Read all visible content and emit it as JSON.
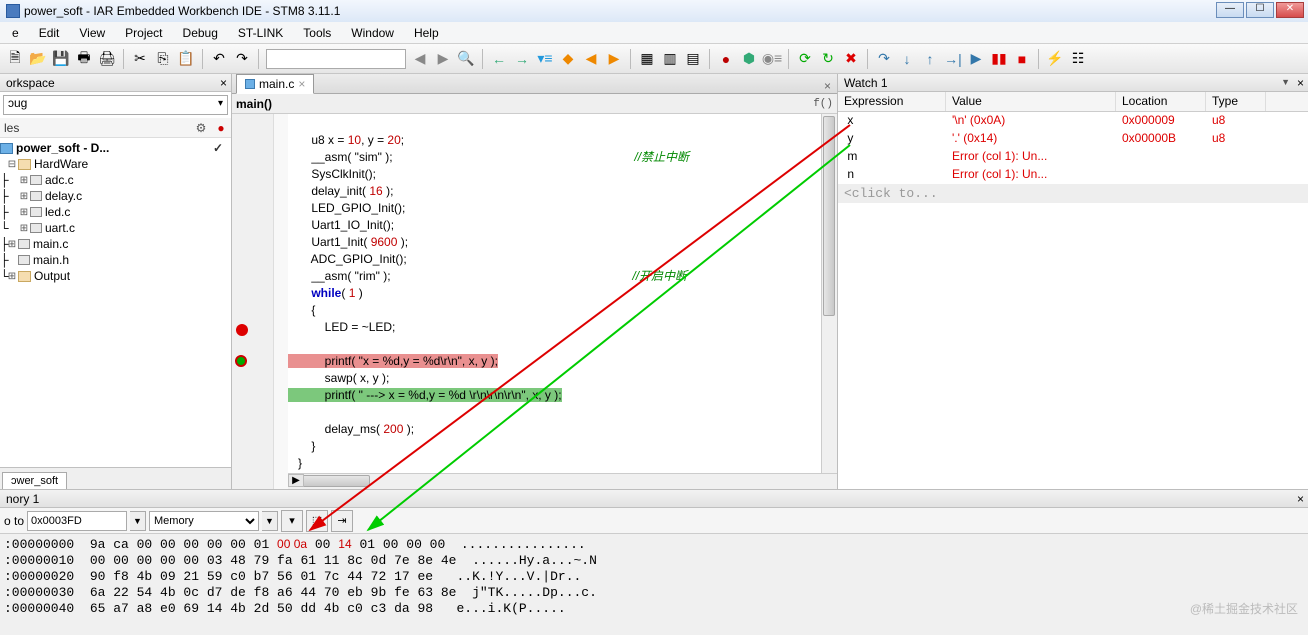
{
  "title": "power_soft - IAR Embedded Workbench IDE - STM8 3.11.1",
  "menu": [
    "e",
    "Edit",
    "View",
    "Project",
    "Debug",
    "ST-LINK",
    "Tools",
    "Window",
    "Help"
  ],
  "workspace": {
    "header": "orkspace",
    "dropdown": "ɔug",
    "files_label": "les",
    "project": "power_soft - D...",
    "hardware": "HardWare",
    "files": [
      "adc.c",
      "delay.c",
      "led.c",
      "uart.c"
    ],
    "main_c": "main.c",
    "main_h": "main.h",
    "output": "Output",
    "tab": "ɔwer_soft"
  },
  "editor": {
    "tab": "main.c",
    "func": "main()",
    "fo": "f()",
    "lines": {
      "l0": "       u8 x = ",
      "l0n1": "10",
      "l0m": ", y = ",
      "l0n2": "20",
      "l0e": ";",
      "l1": "       __asm( \"sim\" );",
      "l1c": "//禁止中断",
      "l2": "       SysClkInit();",
      "l3": "       delay_init( ",
      "l3n": "16",
      "l3e": " );",
      "l4": "       LED_GPIO_Init();",
      "l5": "       Uart1_IO_Init();",
      "l6": "       Uart1_Init( ",
      "l6n": "9600",
      "l6e": " );",
      "l7": "       ADC_GPIO_Init();",
      "l8": "       __asm( \"rim\" );",
      "l8c": "//开启中断",
      "l9a": "       ",
      "l9k": "while",
      "l9b": "( ",
      "l9n": "1",
      "l9e": " )",
      "l10": "       {",
      "l11": "           LED = ~LED;",
      "l12": "",
      "l13a": "           printf( \"x = %d,y = %d\\r\\n\", x, y );",
      "l14": "           sawp( x, y );",
      "l15a": "           printf( \" ---> x = %d,y = %d \\r\\n\\r\\n\\r\\n\", x, y );",
      "l16": "",
      "l17": "           delay_ms( ",
      "l17n": "200",
      "l17e": " );",
      "l18": "       }",
      "l19": "   }"
    }
  },
  "watch": {
    "header": "Watch 1",
    "th_expr": "Expression",
    "th_val": "Value",
    "th_loc": "Location",
    "th_type": "Type",
    "rows": [
      {
        "expr": "x",
        "val": "'\\n' (0x0A)",
        "loc": "0x000009",
        "type": "u8",
        "red": true
      },
      {
        "expr": "y",
        "val": "'.' (0x14)",
        "loc": "0x00000B",
        "type": "u8",
        "red": true
      },
      {
        "expr": "m",
        "val": "Error (col 1): Un...",
        "loc": "",
        "type": "",
        "red": true
      },
      {
        "expr": "n",
        "val": "Error (col 1): Un...",
        "loc": "",
        "type": "",
        "red": true
      }
    ],
    "click_add": "<click to..."
  },
  "memory": {
    "header": "nory 1",
    "goto_label": "o to",
    "goto_addr": "0x0003FD",
    "region": "Memory",
    "lines": [
      {
        "addr": ":00000000",
        "hex": "9a ca 00 00 00 00 00 01 ",
        "hl": "00 0a",
        "hex2": " 00 ",
        "hl2": "14",
        "hex3": " 01 00 00 00",
        "asc": "  ................"
      },
      {
        "addr": ":00000010",
        "hex": "00 00 00 00 00 03 48 79 fa 61 11 8c 0d 7e 8e 4e",
        "asc": "  ......Hy.a...~.N"
      },
      {
        "addr": ":00000020",
        "hex": "90 f8 4b 09 21 59 c0 b7 56 01 7c 44 72 17 ee",
        "asc": "   ..K.!Y...V.|Dr.."
      },
      {
        "addr": ":00000030",
        "hex": "6a 22 54 4b 0c d7 de f8 a6 44 70 eb 9b fe 63 8e",
        "asc": "  j\"TK.....Dp...c."
      },
      {
        "addr": ":00000040",
        "hex": "65 a7 a8 e0 69 14 4b 2d 50 dd 4b c0 c3 da 98",
        "asc": "   e...i.K(P....."
      }
    ]
  },
  "watermark": "@稀土掘金技术社区"
}
